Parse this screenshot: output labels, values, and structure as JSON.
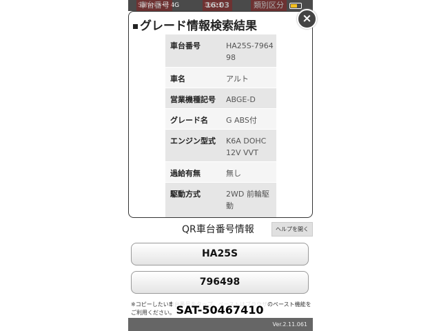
{
  "status_bar": {
    "carrier": "Safari ••ll 4G",
    "time": "16:03"
  },
  "background_header": {
    "col1": "車台番号",
    "col2": "16:03",
    "col3": "類別区分"
  },
  "modal": {
    "title": "グレード情報検索結果",
    "rows": [
      {
        "label": "車台番号",
        "value": "HA25S-796498"
      },
      {
        "label": "車名",
        "value": "アルト"
      },
      {
        "label": "営業機種記号",
        "value": "ABGE-D"
      },
      {
        "label": "グレード名",
        "value": "G ABS付"
      },
      {
        "label": "エンジン型式",
        "value": "K6A DOHC 12V VVT"
      },
      {
        "label": "過給有無",
        "value": "無し"
      },
      {
        "label": "駆動方式",
        "value": "2WD 前輪駆動"
      }
    ]
  },
  "qr": {
    "title": "QR車台番号情報",
    "help_label": "ヘルプを開く",
    "button1": "HA25S",
    "button2": "796498",
    "note": "※コピーしたい車台番号をタップ。ペーストはブラウザのペースト機能をご利用ください。"
  },
  "overlay_label": "SAT-50467410",
  "footer": {
    "version": "Ver.2.11.061"
  }
}
